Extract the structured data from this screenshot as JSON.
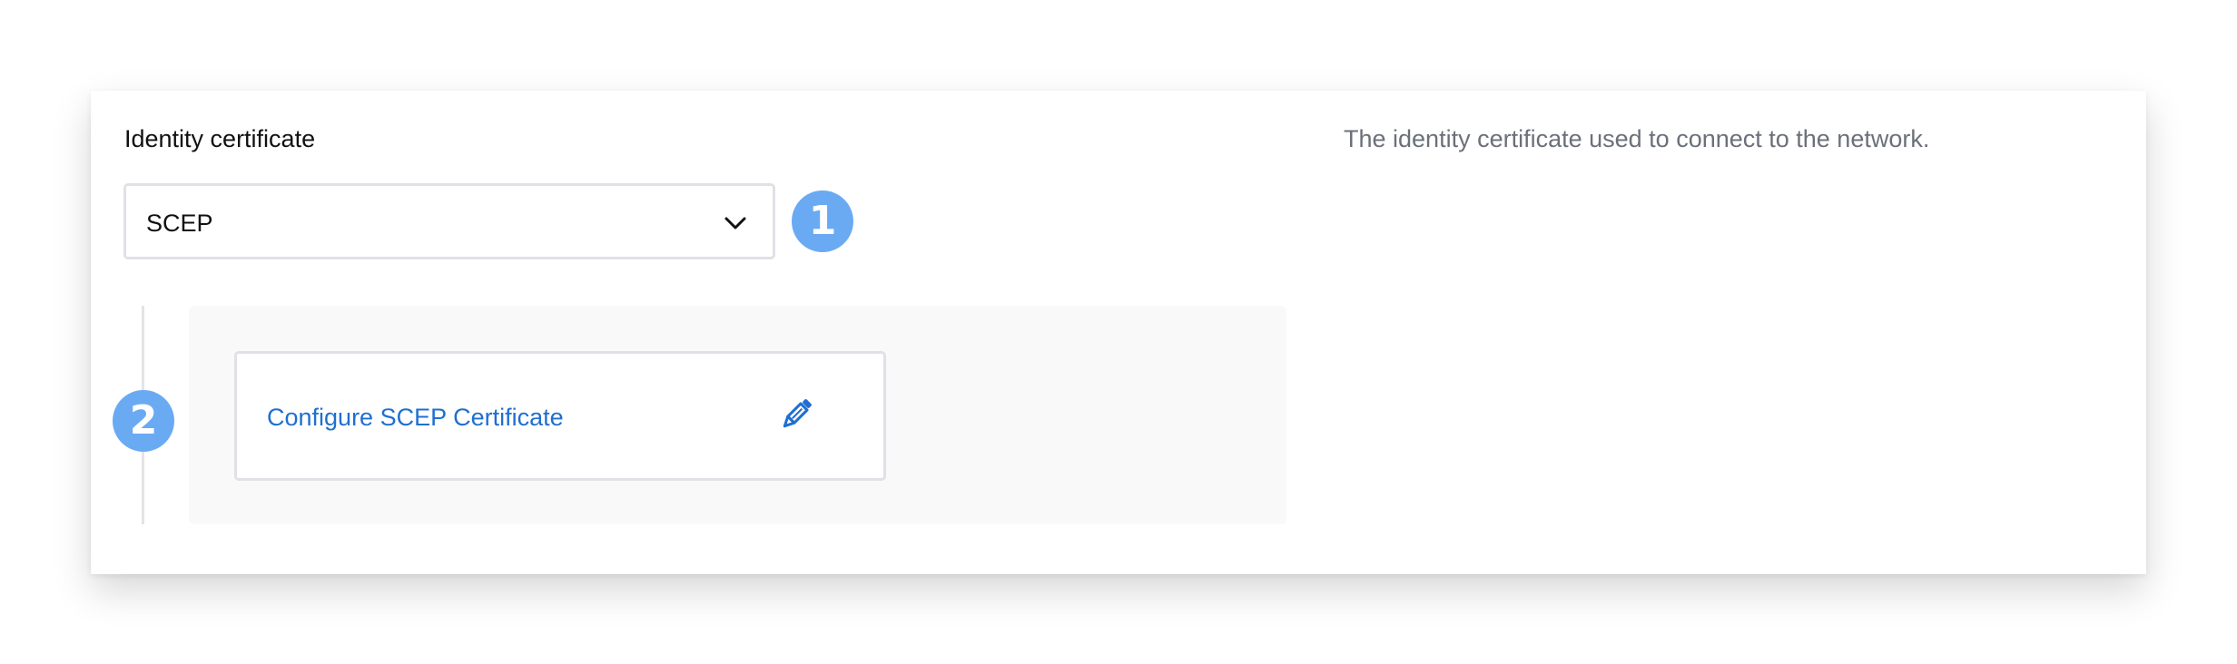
{
  "identity_certificate": {
    "label": "Identity certificate",
    "description": "The identity certificate used to connect to the network.",
    "select": {
      "value": "SCEP",
      "icon": "chevron-down-icon"
    }
  },
  "step_badges": {
    "first": "1",
    "second": "2"
  },
  "scep_config": {
    "link_label": "Configure SCEP Certificate",
    "edit_icon": "pencil-icon"
  },
  "colors": {
    "badge": "#6aaaf3",
    "link": "#1f6fd1",
    "description_text": "#6b7079",
    "border": "#dfe1e6",
    "panel_bg": "#f9f9fa"
  }
}
